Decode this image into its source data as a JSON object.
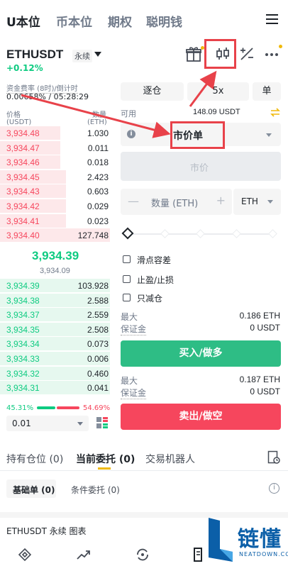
{
  "top_tabs": [
    "U本位",
    "币本位",
    "期权",
    "聪明钱"
  ],
  "symbol": {
    "name": "ETHUSDT",
    "tag": "永续",
    "change": "+0.12%"
  },
  "funding": {
    "label": "资金费率 (8时)/倒计时",
    "value": "0.00658% / 05:28:29"
  },
  "orderbook": {
    "price_header": "价格",
    "price_unit": "(USDT)",
    "qty_header": "数量",
    "qty_unit": "(ETH)",
    "asks": [
      {
        "price": "3,934.48",
        "qty": "1.030",
        "depth": 0.55
      },
      {
        "price": "3,934.47",
        "qty": "0.011",
        "depth": 0.55
      },
      {
        "price": "3,934.46",
        "qty": "0.018",
        "depth": 0.55
      },
      {
        "price": "3,934.45",
        "qty": "2.423",
        "depth": 0.6
      },
      {
        "price": "3,934.43",
        "qty": "0.603",
        "depth": 0.6
      },
      {
        "price": "3,934.42",
        "qty": "0.029",
        "depth": 0.6
      },
      {
        "price": "3,934.41",
        "qty": "0.023",
        "depth": 0.6
      },
      {
        "price": "3,934.40",
        "qty": "127.748",
        "depth": 1.0
      }
    ],
    "last_price": "3,934.39",
    "mark_price": "3,934.09",
    "bids": [
      {
        "price": "3,934.39",
        "qty": "103.928",
        "depth": 1.0
      },
      {
        "price": "3,934.38",
        "qty": "2.588",
        "depth": 1.0
      },
      {
        "price": "3,934.37",
        "qty": "2.559",
        "depth": 1.0
      },
      {
        "price": "3,934.35",
        "qty": "2.508",
        "depth": 1.0
      },
      {
        "price": "3,934.34",
        "qty": "0.073",
        "depth": 1.0
      },
      {
        "price": "3,934.33",
        "qty": "0.006",
        "depth": 1.0
      },
      {
        "price": "3,934.32",
        "qty": "0.460",
        "depth": 1.0
      },
      {
        "price": "3,934.31",
        "qty": "0.041",
        "depth": 1.0
      }
    ],
    "buy_ratio": "45.31%",
    "sell_ratio": "54.69%",
    "precision": "0.01"
  },
  "order_form": {
    "margin_mode": "逐仓",
    "leverage": "5x",
    "position_mode": "单",
    "available_label": "可用",
    "available_value": "148.09 USDT",
    "order_type": "市价单",
    "price_placeholder": "市价",
    "qty_placeholder": "数量 (ETH)",
    "qty_unit": "ETH",
    "options": [
      "滑点容差",
      "止盈/止损",
      "只减仓"
    ],
    "buy_max_label": "最大",
    "buy_max_value": "0.186 ETH",
    "buy_margin_label": "保证金",
    "buy_margin_value": "0 USDT",
    "buy_button": "买入/做多",
    "sell_max_label": "最大",
    "sell_max_value": "0.187 ETH",
    "sell_margin_label": "保证金",
    "sell_margin_value": "0 USDT",
    "sell_button": "卖出/做空"
  },
  "bottom_tabs": [
    "持有仓位 (0)",
    "当前委托 (0)",
    "交易机器人"
  ],
  "sub_tabs": [
    "基础单 (0)",
    "条件委托 (0)"
  ],
  "chart_label": "ETHUSDT 永续  图表",
  "logo": {
    "text": "链懂",
    "sub": "NEATDOWN.COM"
  }
}
